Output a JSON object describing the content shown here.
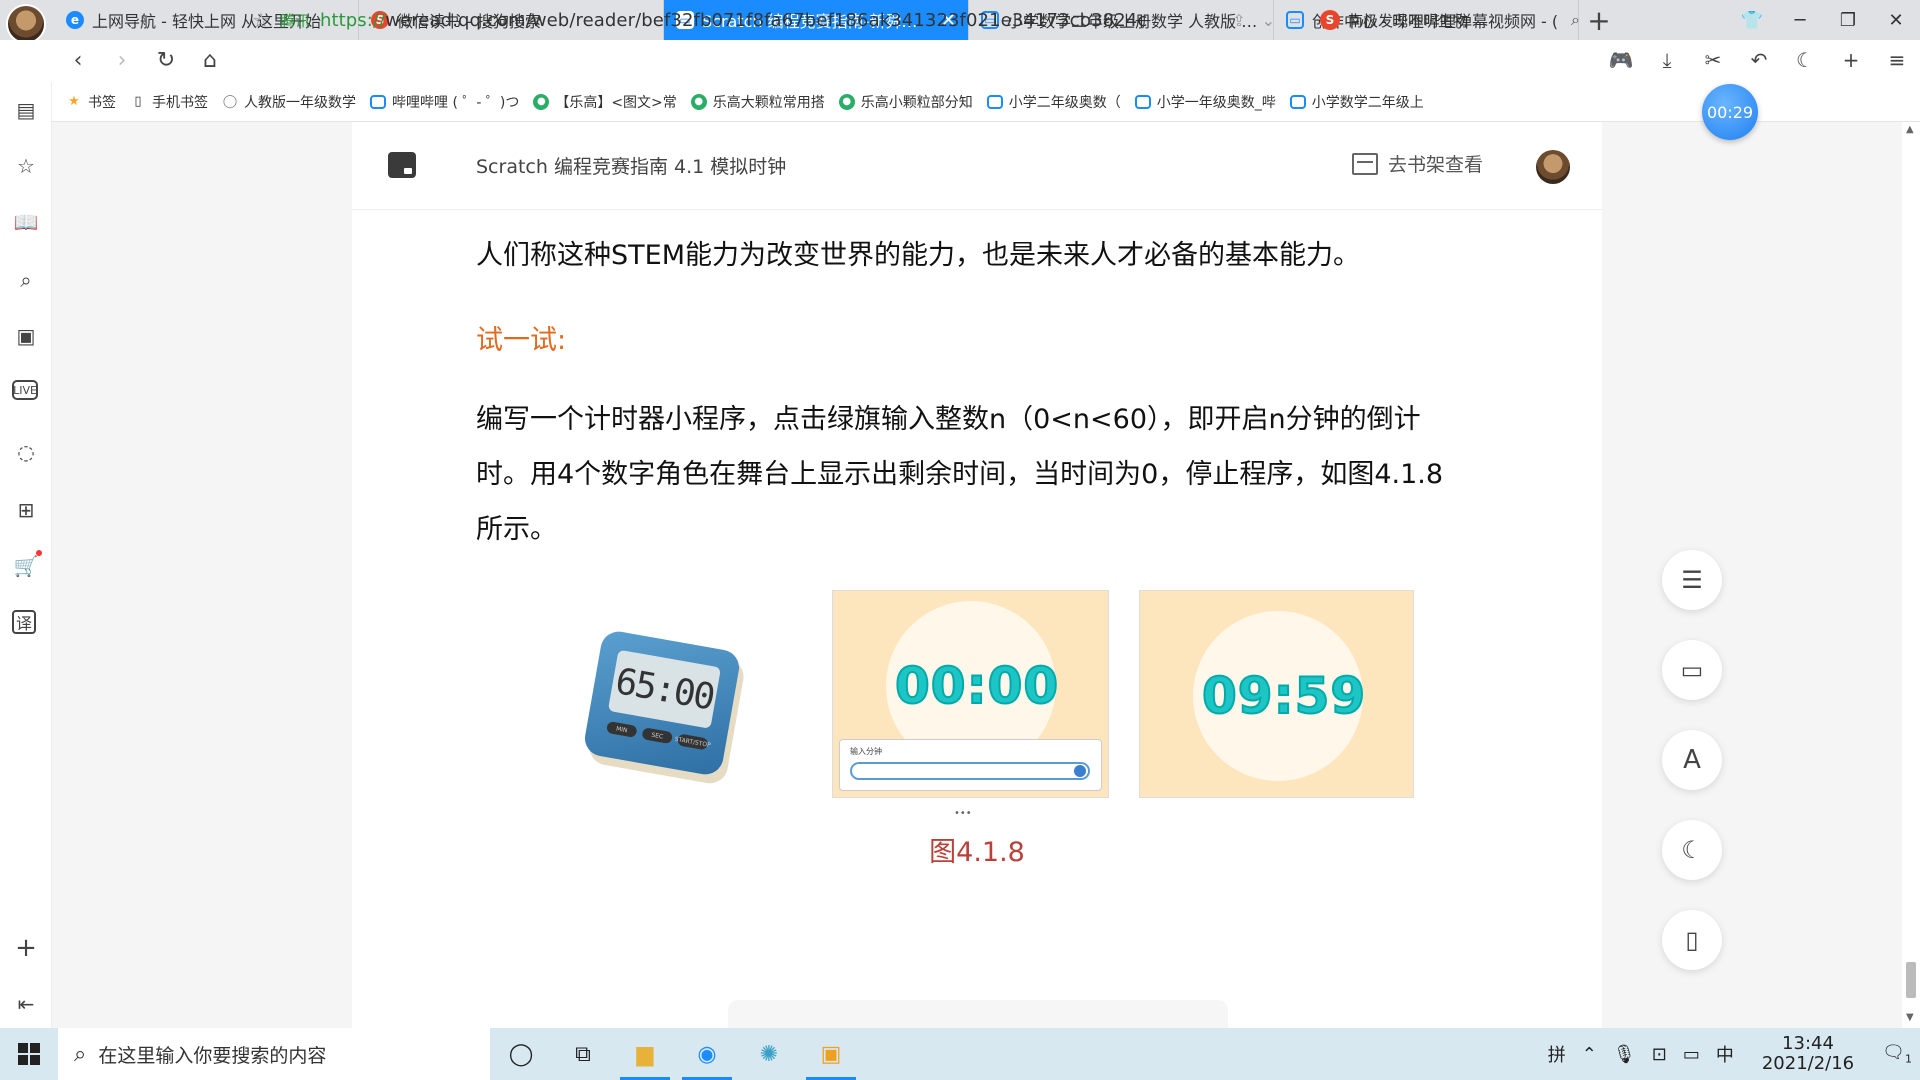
{
  "tabs": [
    {
      "label": "上网导航 - 轻快上网 从这里开始",
      "icon": "e"
    },
    {
      "label": "微信读书 - 搜狗搜索",
      "icon": "S"
    },
    {
      "label": "Scratch 编程竞赛指南-新舜尧 阅读",
      "icon": "▭",
      "active": true
    },
    {
      "label": "小学数学二年级上册数学 人教版 202",
      "icon": "▭"
    },
    {
      "label": "创作中心 - 哔哩哔哩弹幕视频网 - (",
      "icon": "▭"
    }
  ],
  "address": {
    "site_tag": "腾讯",
    "url_scheme": "https://",
    "url_rest": "weread.qq.com/web/reader/bef32fb071f8fa67bef186ak341323f021e34173cb3824c"
  },
  "search": {
    "engine_icon": "S",
    "text": "南极发现不明生物"
  },
  "bookmarks": [
    {
      "label": "书签",
      "icon": "★"
    },
    {
      "label": "手机书签",
      "icon": "▯"
    },
    {
      "label": "人教版一年级数学",
      "icon": "◯"
    },
    {
      "label": "哔哩哔哩 ( ゜- ゜)つ",
      "icon": "bili"
    },
    {
      "label": "【乐高】<图文>常",
      "icon": "wechat"
    },
    {
      "label": "乐高大颗粒常用搭",
      "icon": "wechat"
    },
    {
      "label": "乐高小颗粒部分知",
      "icon": "wechat"
    },
    {
      "label": "小学二年级奥数（",
      "icon": "bili"
    },
    {
      "label": "小学一年级奥数_哔",
      "icon": "bili"
    },
    {
      "label": "小学数学二年级上",
      "icon": "bili"
    }
  ],
  "timer_badge": "00:29",
  "reader": {
    "book_title": "Scratch 编程竞赛指南 4.1 模拟时钟",
    "shelf_label": "去书架查看",
    "para1": "人们称这种STEM能力为改变世界的能力，也是未来人才必备的基本能力。",
    "try_label": "试一试:",
    "para2_line1": "编写一个计时器小程序，点击绿旗输入整数n（0<n<60），即开启n分钟的倒计",
    "para2_line2": "时。用4个数字角色在舞台上显示出剩余时间，当时间为0，停止程序，如图4.1.8",
    "para2_line3": "所示。",
    "figure": {
      "timer_display": "65:00",
      "timer_buttons": [
        "MIN",
        "SEC",
        "START/STOP"
      ],
      "clock1": "00:00",
      "input_label": "输入分钟",
      "clock2": "09:59",
      "caption": "图4.1.8"
    }
  },
  "taskbar": {
    "search_placeholder": "在这里输入你要搜索的内容",
    "ime": "拼",
    "lang": "中",
    "time": "13:44",
    "date": "2021/2/16",
    "notification_count": "1"
  },
  "colors": {
    "accent": "#1a8cff",
    "try_label": "#e06b1f",
    "caption": "#b8423a",
    "figure_bg": "#fde5bd",
    "digits": "#1ec5c5"
  }
}
